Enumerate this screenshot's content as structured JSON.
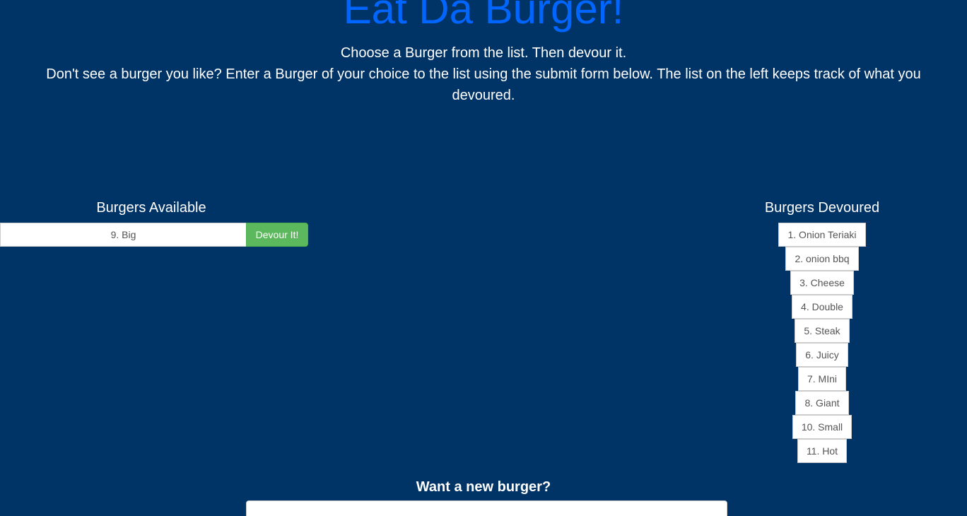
{
  "header": {
    "title": "Eat Da Burger!",
    "intro_line1": "Choose a Burger from the list. Then devour it.",
    "intro_line2": "Don't see a burger you like? Enter a Burger of your choice to the list using the submit form below. The list on the left keeps track of what you devoured."
  },
  "available": {
    "heading": "Burgers Available",
    "items": [
      {
        "label": "9. Big",
        "button": "Devour It!"
      }
    ]
  },
  "devoured": {
    "heading": "Burgers Devoured",
    "items": [
      "1. Onion Teriaki",
      "2. onion bbq",
      "3. Cheese",
      "4. Double",
      "5. Steak",
      "6. Juicy",
      "7. MIni",
      "8. Giant",
      "10. Small",
      "11. Hot"
    ]
  },
  "form": {
    "heading": "Want a new burger?",
    "input_value": ""
  },
  "colors": {
    "background": "#003366",
    "title": "#0066ff",
    "devour_button": "#5cb85c"
  }
}
